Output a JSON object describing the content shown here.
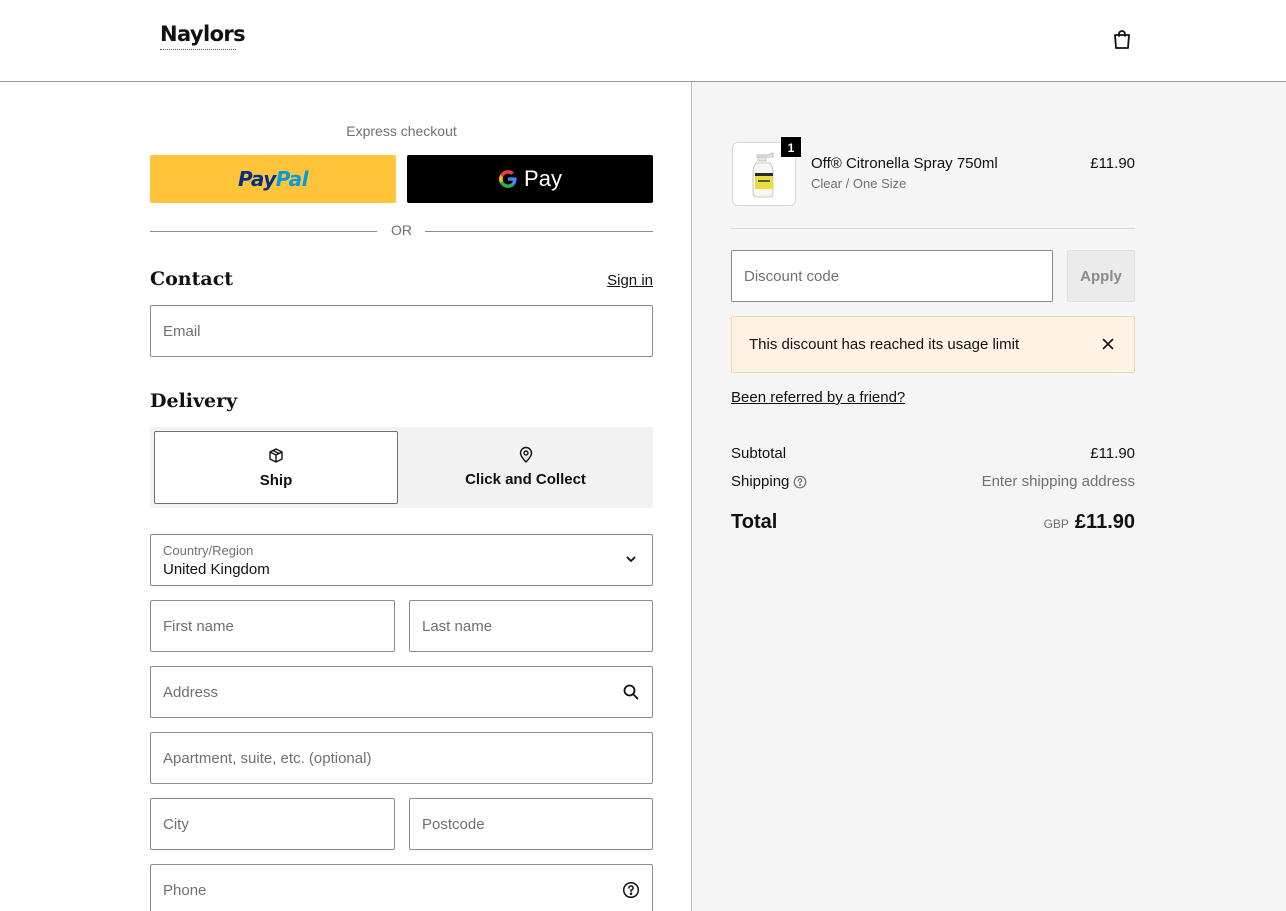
{
  "header": {
    "logo_text": "Naylors",
    "cart_icon": "shopping-bag-icon"
  },
  "express": {
    "label": "Express checkout",
    "paypal_label_1": "Pay",
    "paypal_label_2": "Pal",
    "gpay_label": "Pay",
    "separator": "OR"
  },
  "contact": {
    "title": "Contact",
    "signin": "Sign in",
    "email_placeholder": "Email"
  },
  "delivery": {
    "title": "Delivery",
    "options": [
      {
        "label": "Ship",
        "icon": "package-icon",
        "selected": true
      },
      {
        "label": "Click and Collect",
        "icon": "location-pin-icon",
        "selected": false
      }
    ],
    "country_label": "Country/Region",
    "country_value": "United Kingdom",
    "first_name_placeholder": "First name",
    "last_name_placeholder": "Last name",
    "address_placeholder": "Address",
    "apartment_placeholder": "Apartment, suite, etc. (optional)",
    "city_placeholder": "City",
    "postcode_placeholder": "Postcode",
    "phone_placeholder": "Phone"
  },
  "cart": {
    "items": [
      {
        "name": "Off® Citronella Spray 750ml",
        "variant": "Clear / One Size",
        "price": "£11.90",
        "quantity": "1"
      }
    ],
    "discount_placeholder": "Discount code",
    "apply_label": "Apply",
    "alert_text": "This discount has reached its usage limit",
    "referral_link": "Been referred by a friend?",
    "subtotal_label": "Subtotal",
    "subtotal_value": "£11.90",
    "shipping_label": "Shipping",
    "shipping_value": "Enter shipping address",
    "total_label": "Total",
    "total_currency": "GBP",
    "total_value": "£11.90"
  }
}
